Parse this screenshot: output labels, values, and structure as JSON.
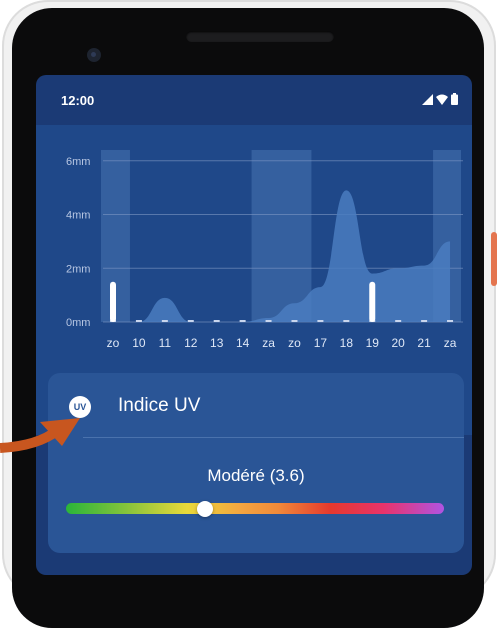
{
  "colors": {
    "screen_bg": "#1b3a75",
    "chart_bg": "#1f4889",
    "card_bg": "#2a5596",
    "highlight_band": "#35609f",
    "rain_area": "#4a7cc0",
    "arrow": "#c8561f"
  },
  "status_bar": {
    "time": "12:00",
    "icons": [
      "signal-icon",
      "wifi-icon",
      "battery-icon"
    ]
  },
  "chart_data": {
    "type": "area",
    "y_unit": "mm",
    "yticks": [
      "6mm",
      "4mm",
      "2mm",
      "0mm"
    ],
    "ytick_values": [
      6,
      4,
      2,
      0
    ],
    "ylim": [
      0,
      6.4
    ],
    "x_labels": [
      "zo",
      "10",
      "11",
      "12",
      "13",
      "14",
      "za",
      "zo",
      "17",
      "18",
      "19",
      "20",
      "21",
      "za"
    ],
    "series": [
      {
        "values": [
          0,
          0,
          0.9,
          0,
          0,
          0,
          0.15,
          0.7,
          1.3,
          4.9,
          1.8,
          2.0,
          2.1,
          3.0
        ]
      }
    ],
    "markers_at": [
      0,
      10
    ],
    "marker_value": 1.0,
    "highlight_ranges": [
      [
        0,
        0
      ],
      [
        6,
        7
      ],
      [
        13,
        13
      ]
    ],
    "grid": true
  },
  "uv_card": {
    "badge": "UV",
    "title": "Indice UV",
    "level_text": "Modéré (3.6)",
    "value": 3.6,
    "scale_max": 11,
    "slider_fraction": 0.368
  }
}
